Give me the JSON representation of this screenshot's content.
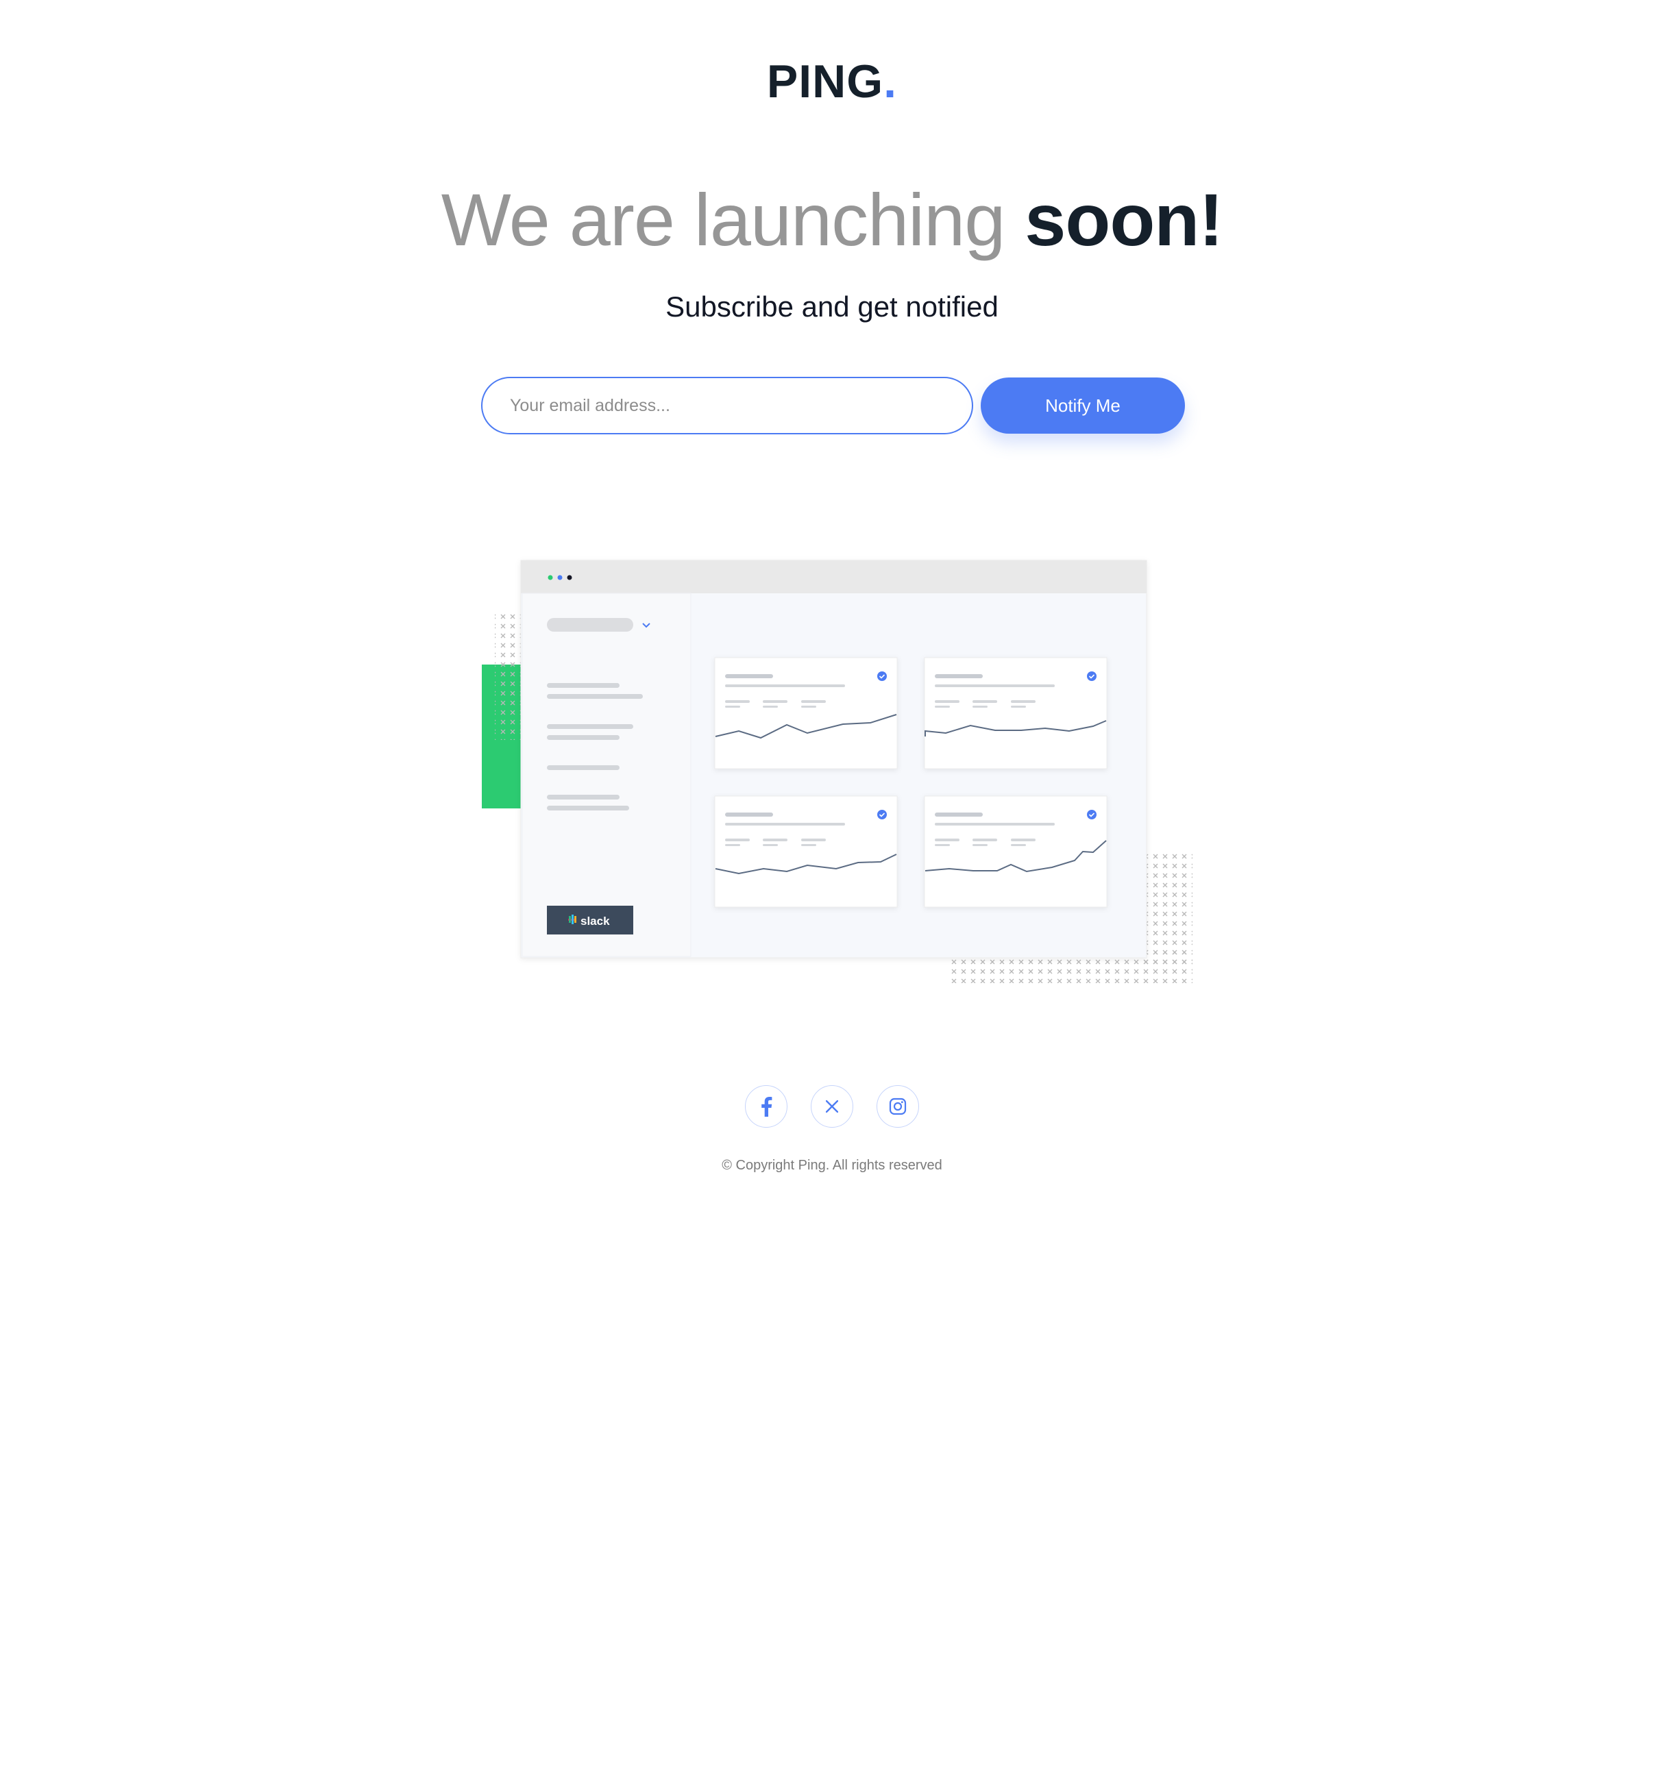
{
  "brand": {
    "name": "PING",
    "dot": ".",
    "accent": "#4c7bf3",
    "dark": "#15202b"
  },
  "hero": {
    "title_light": "We are launching",
    "title_strong": "soon!",
    "subtitle": "Subscribe and get notified"
  },
  "form": {
    "email_placeholder": "Your email address...",
    "email_value": "",
    "submit_label": "Notify Me"
  },
  "illustration": {
    "sidebar_button_label": "slack",
    "window_dots": [
      "#2ccb71",
      "#4c7bf3",
      "#121725"
    ],
    "decor_green": "#2ccb71"
  },
  "social": {
    "items": [
      {
        "icon": "facebook-icon"
      },
      {
        "icon": "x-twitter-icon"
      },
      {
        "icon": "instagram-icon"
      }
    ]
  },
  "footer": {
    "copyright": "© Copyright Ping. All rights reserved"
  }
}
